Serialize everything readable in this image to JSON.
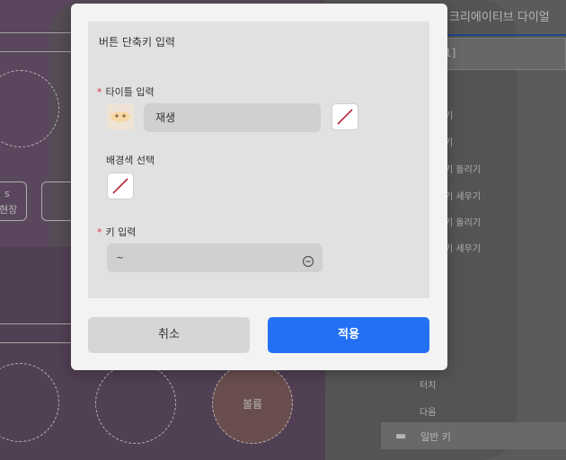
{
  "background": {
    "panel_title": "크리에이티브 다이얼",
    "select_value": "1]",
    "list_items": [
      "기",
      "기",
      "기 돌리기",
      "기 세우기",
      "기 돌리기",
      "기 세우기"
    ],
    "button_fragment_1": "s",
    "button_fragment_2": "현장",
    "circle_label": "볼륨",
    "folder_label": "일반 키",
    "small_item_1": "터치",
    "small_item_2": "다음"
  },
  "dialog": {
    "title": "버튼 단축키 입력",
    "title_field": {
      "label": "타이틀 입력",
      "required_mark": "*",
      "value": "재생"
    },
    "bg_color": {
      "label": "배경색 선택"
    },
    "key_field": {
      "label": "키 입력",
      "required_mark": "*",
      "value": "~"
    },
    "cancel_label": "취소",
    "apply_label": "적용"
  },
  "colors": {
    "accent": "#2370f5",
    "required": "#d9304c",
    "none_slash": "#b3263c"
  }
}
